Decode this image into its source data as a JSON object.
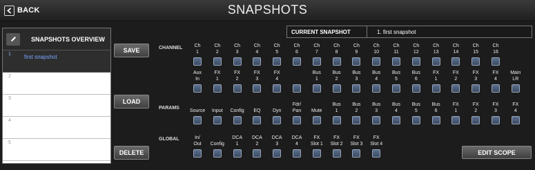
{
  "header": {
    "back_label": "BACK",
    "title": "SNAPSHOTS",
    "back_icon": "chevron-left-icon"
  },
  "overview": {
    "title": "SNAPSHOTS OVERVIEW",
    "edit_icon": "pencil-icon",
    "slots": [
      {
        "num": "1",
        "name": "first snapshot"
      },
      {
        "num": "2",
        "name": ""
      },
      {
        "num": "3",
        "name": ""
      },
      {
        "num": "4",
        "name": ""
      },
      {
        "num": "5",
        "name": ""
      }
    ]
  },
  "actions": {
    "save": "SAVE",
    "load": "LOAD",
    "delete": "DELETE",
    "edit_scope": "EDIT SCOPE"
  },
  "current": {
    "label": "CURRENT SNAPSHOT",
    "value": "1. first snapshot"
  },
  "sections": {
    "channel": "CHANNEL",
    "params": "PARAMS",
    "global": "GLOBAL"
  },
  "channel_row1": [
    "Ch\n1",
    "Ch\n2",
    "Ch\n3",
    "Ch\n4",
    "Ch\n5",
    "Ch\n6",
    "Ch\n7",
    "Ch\n8",
    "Ch\n9",
    "Ch\n10",
    "Ch\n11",
    "Ch\n12",
    "Ch\n13",
    "Ch\n14",
    "Ch\n15",
    "Ch\n16"
  ],
  "channel_row2": [
    "Aux\nIn",
    "FX\n1",
    "FX\n2",
    "FX\n3",
    "FX\n4",
    "",
    "Bus\n1",
    "Bus\n2",
    "Bus\n3",
    "Bus\n4",
    "Bus\n5",
    "Bus\n6",
    "FX\n1",
    "FX\n2",
    "FX\n3",
    "FX\n4",
    "Main\nLR"
  ],
  "params_row": [
    "Source",
    "Input",
    "Config",
    "EQ",
    "Dyn",
    "Fdr/\nPan",
    "Mute",
    "Bus\n1",
    "Bus\n2",
    "Bus\n3",
    "Bus\n4",
    "Bus\n5",
    "Bus\n6",
    "FX\n1",
    "FX\n2",
    "FX\n3",
    "FX\n4"
  ],
  "global_row": [
    "In/\nOut",
    "Config",
    "DCA\n1",
    "DCA\n2",
    "DCA\n3",
    "DCA\n4",
    "FX\nSlot 1",
    "FX\nSlot 2",
    "FX\nSlot 3",
    "FX\nSlot 4"
  ],
  "colors": {
    "background": "#1c1c1c",
    "checkbox": "#4a5b76",
    "link_text": "#7aa6ff"
  }
}
